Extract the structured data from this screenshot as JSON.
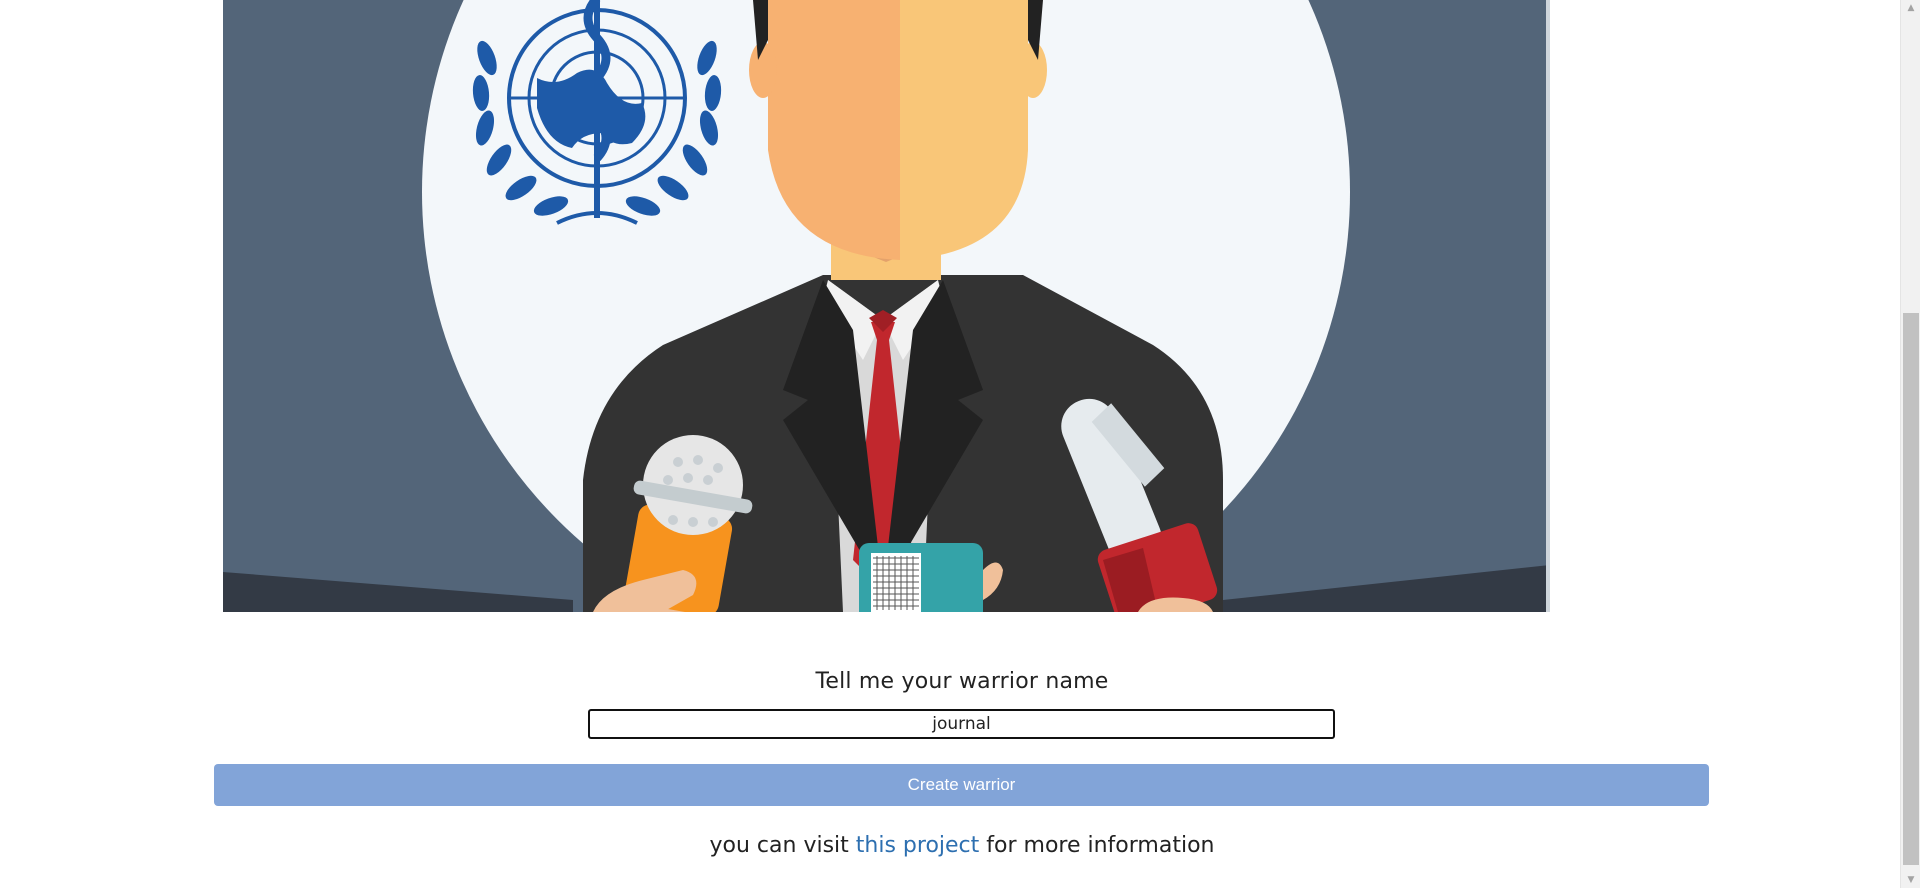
{
  "hero": {
    "image_name": "press-conference-illustration",
    "colors": {
      "background": "#536579",
      "circle": "#f3f7fa",
      "suit": "#333333",
      "tie": "#c1272d",
      "skin_left": "#f7b171",
      "skin_right": "#f9c678",
      "who_blue": "#1e5aa8"
    }
  },
  "form": {
    "prompt_label": "Tell me your warrior name",
    "name_value": "journal",
    "create_button_label": "Create warrior"
  },
  "footer": {
    "text_before": "you can visit ",
    "link_text": "this project",
    "text_after": " for more information"
  },
  "colors": {
    "button_bg": "#82a4d8",
    "link": "#2d6fb0"
  }
}
